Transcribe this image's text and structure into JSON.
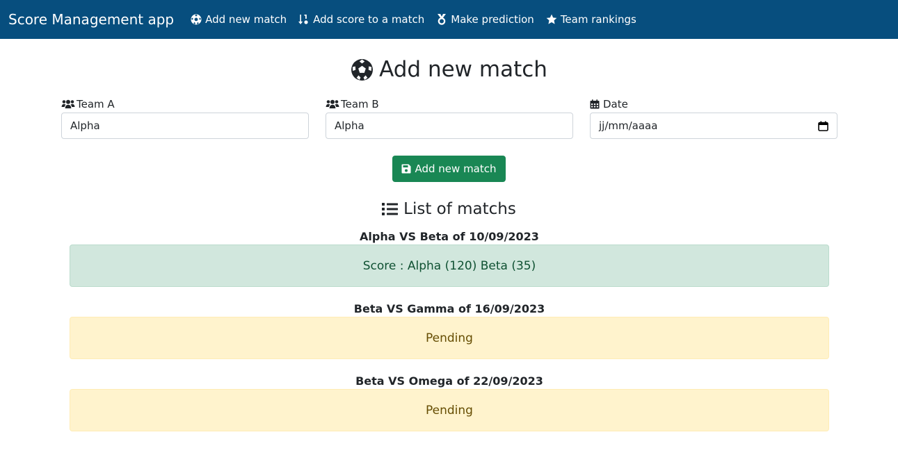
{
  "navbar": {
    "brand": "Score Management app",
    "links": [
      {
        "label": "Add new match",
        "icon": "futbol-icon"
      },
      {
        "label": "Add score to a match",
        "icon": "sort-numeric-icon"
      },
      {
        "label": "Make prediction",
        "icon": "medal-icon"
      },
      {
        "label": "Team rankings",
        "icon": "star-icon"
      }
    ]
  },
  "page": {
    "title": "Add new match"
  },
  "form": {
    "team_a_label": "Team A",
    "team_a_value": "Alpha",
    "team_b_label": "Team B",
    "team_b_value": "Alpha",
    "date_label": "Date",
    "date_placeholder": "jj/mm/aaaa",
    "submit_label": "Add new match"
  },
  "list": {
    "title": "List of matchs",
    "matches": [
      {
        "title": "Alpha VS Beta of 10/09/2023",
        "status": "Score : Alpha (120) Beta (35)",
        "state": "done"
      },
      {
        "title": "Beta VS Gamma of 16/09/2023",
        "status": "Pending",
        "state": "pending"
      },
      {
        "title": "Beta VS Omega of 22/09/2023",
        "status": "Pending",
        "state": "pending"
      }
    ]
  },
  "colors": {
    "navbar": "#074e7e",
    "button": "#198754",
    "done_bg": "#d1e7dd",
    "pending_bg": "#fff3cd"
  }
}
